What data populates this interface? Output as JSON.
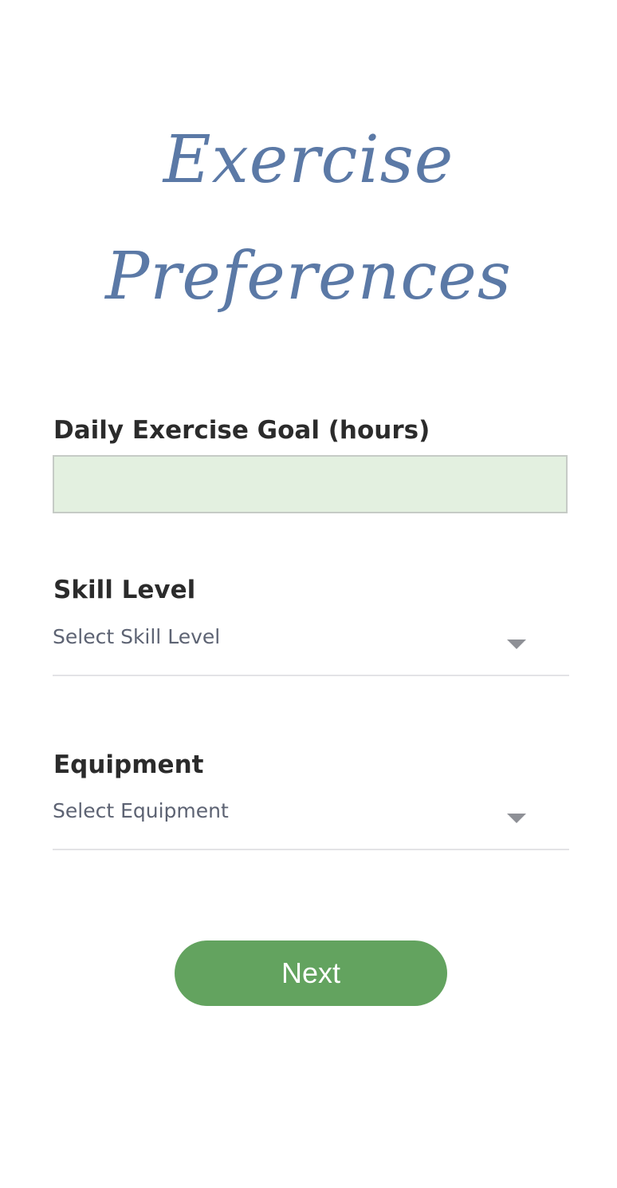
{
  "header": {
    "title_line1": "Exercise",
    "title_line2": "Preferences"
  },
  "form": {
    "daily_goal": {
      "label": "Daily Exercise Goal (hours)",
      "value": "",
      "placeholder": ""
    },
    "skill_level": {
      "label": "Skill Level",
      "selected": "Select Skill Level",
      "icon": "chevron-down-icon"
    },
    "equipment": {
      "label": "Equipment",
      "selected": "Select Equipment",
      "icon": "chevron-down-icon"
    }
  },
  "actions": {
    "next_label": "Next"
  },
  "colors": {
    "title": "#5b79a6",
    "input_bg": "#e3f0e0",
    "button": "#63a35f"
  }
}
